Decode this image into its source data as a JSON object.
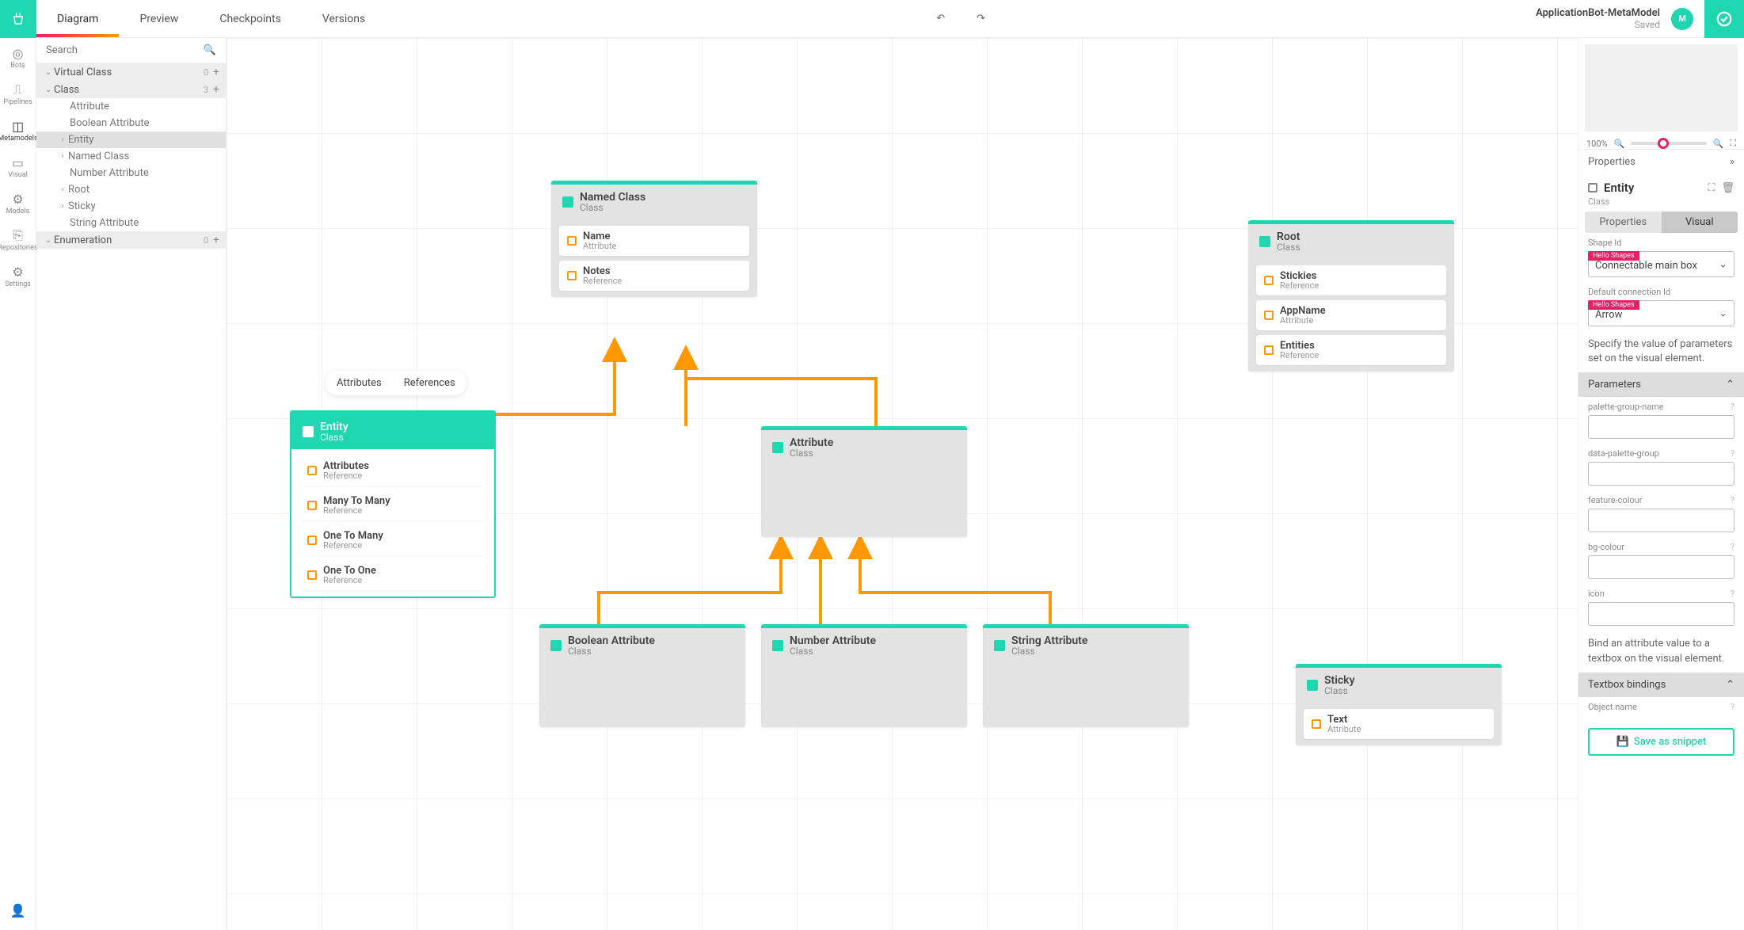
{
  "project": {
    "name": "ApplicationBot-MetaModel",
    "status": "Saved"
  },
  "tabs": [
    {
      "label": "Diagram",
      "active": true
    },
    {
      "label": "Preview"
    },
    {
      "label": "Checkpoints"
    },
    {
      "label": "Versions"
    }
  ],
  "rail": [
    {
      "label": "Bots"
    },
    {
      "label": "Pipelines"
    },
    {
      "label": "Metamodels",
      "active": true
    },
    {
      "label": "Visual"
    },
    {
      "label": "Models"
    },
    {
      "label": "Repositories"
    },
    {
      "label": "Settings"
    }
  ],
  "search": {
    "placeholder": "Search"
  },
  "tree": [
    {
      "label": "Virtual Class",
      "kind": "group",
      "count": "0"
    },
    {
      "label": "Class",
      "kind": "group",
      "count": "3"
    },
    {
      "label": "Attribute",
      "kind": "child"
    },
    {
      "label": "Boolean Attribute",
      "kind": "child"
    },
    {
      "label": "Entity",
      "kind": "child",
      "sel": true,
      "chev": ">"
    },
    {
      "label": "Named Class",
      "kind": "child",
      "chev": ">"
    },
    {
      "label": "Number Attribute",
      "kind": "child"
    },
    {
      "label": "Root",
      "kind": "child",
      "chev": ">"
    },
    {
      "label": "Sticky",
      "kind": "child",
      "chev": ">"
    },
    {
      "label": "String Attribute",
      "kind": "child"
    },
    {
      "label": "Enumeration",
      "kind": "group",
      "count": "0"
    }
  ],
  "pill": {
    "opt1": "Attributes",
    "opt2": "References"
  },
  "nodes": {
    "namedClass": {
      "title": "Named Class",
      "sub": "Class",
      "attrs": [
        {
          "n": "Name",
          "s": "Attribute"
        },
        {
          "n": "Notes",
          "s": "Reference"
        }
      ]
    },
    "entity": {
      "title": "Entity",
      "sub": "Class",
      "attrs": [
        {
          "n": "Attributes",
          "s": "Reference"
        },
        {
          "n": "Many To Many",
          "s": "Reference"
        },
        {
          "n": "One To Many",
          "s": "Reference"
        },
        {
          "n": "One To One",
          "s": "Reference"
        }
      ]
    },
    "attribute": {
      "title": "Attribute",
      "sub": "Class"
    },
    "boolAttr": {
      "title": "Boolean Attribute",
      "sub": "Class"
    },
    "numAttr": {
      "title": "Number Attribute",
      "sub": "Class"
    },
    "strAttr": {
      "title": "String Attribute",
      "sub": "Class"
    },
    "root": {
      "title": "Root",
      "sub": "Class",
      "attrs": [
        {
          "n": "Stickies",
          "s": "Reference"
        },
        {
          "n": "AppName",
          "s": "Attribute"
        },
        {
          "n": "Entities",
          "s": "Reference"
        }
      ]
    },
    "sticky": {
      "title": "Sticky",
      "sub": "Class",
      "attrs": [
        {
          "n": "Text",
          "s": "Attribute"
        }
      ]
    }
  },
  "zoom": {
    "level": "100%"
  },
  "propsPanel": {
    "heading": "Properties",
    "objTitle": "Entity",
    "objType": "Class",
    "subtabs": [
      "Properties",
      "Visual"
    ],
    "shapeId": {
      "label": "Shape Id",
      "badge": "Hello Shapes",
      "value": "Connectable main box"
    },
    "connId": {
      "label": "Default connection Id",
      "badge": "Hello Shapes",
      "value": "Arrow"
    },
    "desc1": "Specify the value of parameters set on the visual element.",
    "paramsHead": "Parameters",
    "params": [
      {
        "label": "palette-group-name"
      },
      {
        "label": "data-palette-group"
      },
      {
        "label": "feature-colour"
      },
      {
        "label": "bg-colour"
      },
      {
        "label": "icon"
      }
    ],
    "desc2": "Bind an attribute value to a textbox on the visual element.",
    "textboxHead": "Textbox bindings",
    "objectName": {
      "label": "Object name"
    },
    "snippet": "Save as snippet"
  }
}
